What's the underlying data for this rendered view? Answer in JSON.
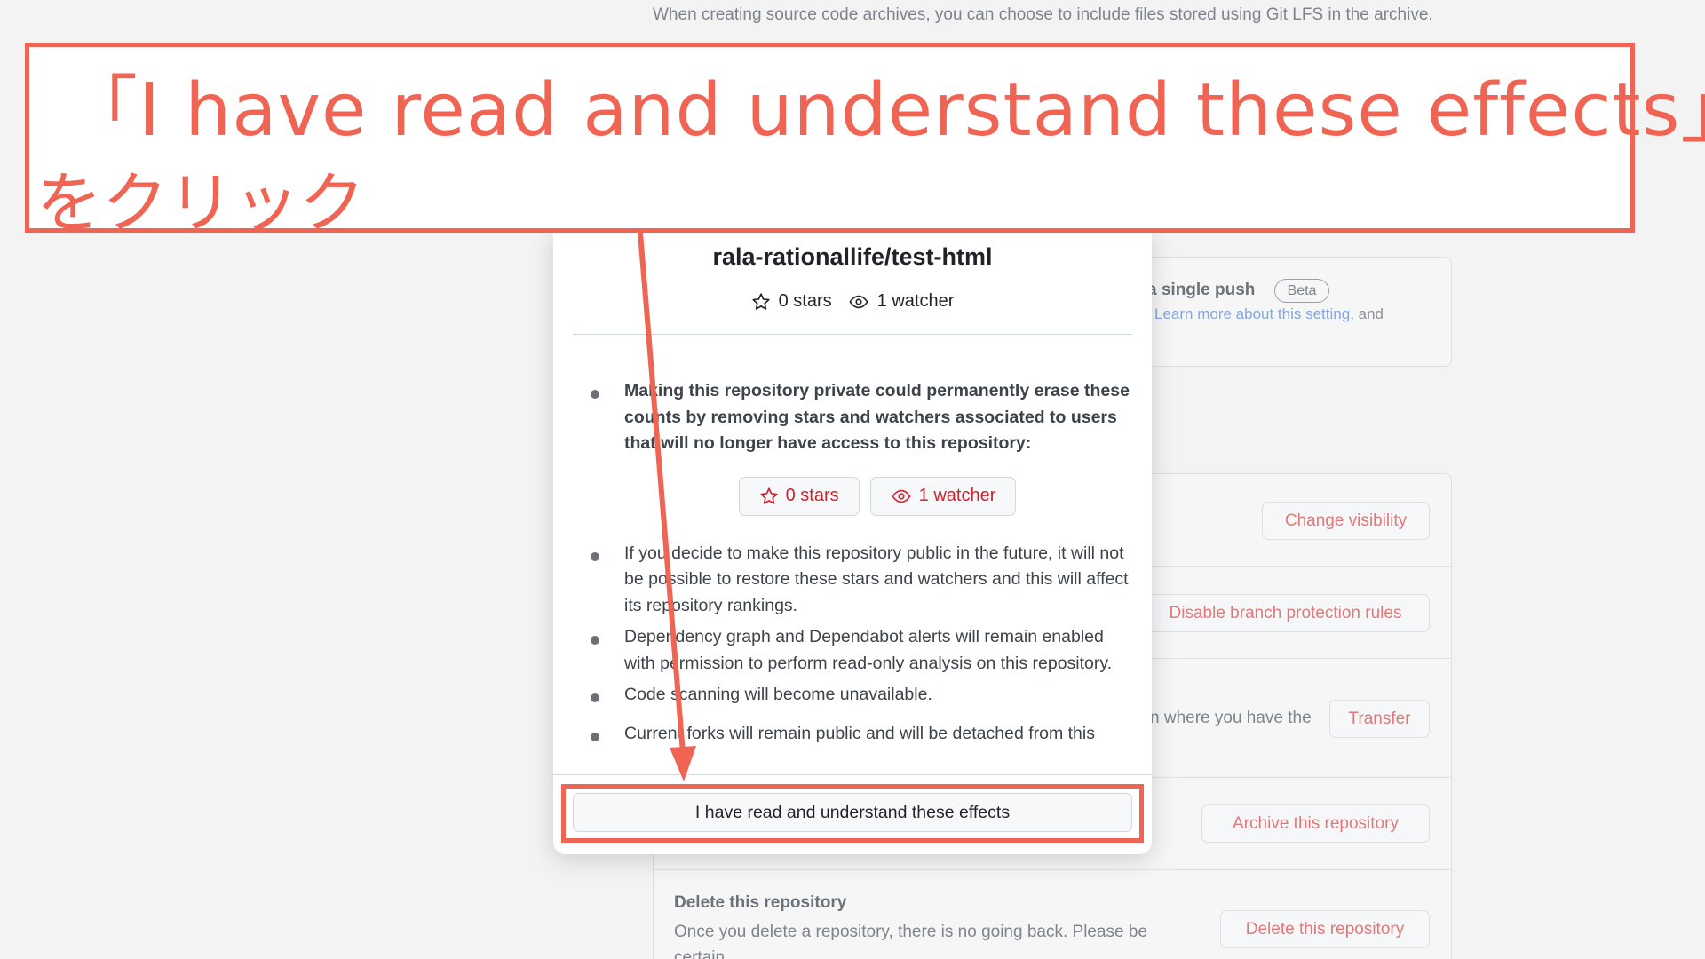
{
  "background": {
    "archive_text": "When creating source code archives, you can choose to include files stored using Git LFS in the archive.",
    "push": {
      "title": "a single push",
      "badge": "Beta",
      "link": "Learn more about this setting",
      "after_link": ", and"
    },
    "transfer_desc": "n where you have the",
    "delete_title": "Delete this repository",
    "delete_desc": "Once you delete a repository, there is no going back. Please be certain.",
    "buttons": {
      "change_visibility": "Change visibility",
      "disable_branch_protection": "Disable branch protection rules",
      "transfer": "Transfer",
      "archive": "Archive this repository",
      "delete": "Delete this repository"
    }
  },
  "modal": {
    "repo_name": "rala-rationallife/test-html",
    "stars": "0 stars",
    "watchers": "1 watcher",
    "effects": [
      "Making this repository private could permanently erase these counts by removing stars and watchers associated to users that will no longer have access to this repository:",
      "If you decide to make this repository public in the future, it will not be possible to restore these stars and watchers and this will affect its repository rankings.",
      "Dependency graph and Dependabot alerts will remain enabled with permission to perform read-only analysis on this repository.",
      "Code scanning will become unavailable.",
      "Current forks will remain public and will be detached from this"
    ],
    "pill_stars": "0 stars",
    "pill_watchers": "1 watcher",
    "confirm_label": "I have read and understand these effects"
  },
  "annotation": {
    "line1": "「I have read and understand these effects」",
    "line2": "をクリック"
  },
  "colors": {
    "annotation": "#f06454",
    "danger": "#cf222e",
    "danger_dim": "#e0797b",
    "link_dim": "#82a8e0"
  }
}
